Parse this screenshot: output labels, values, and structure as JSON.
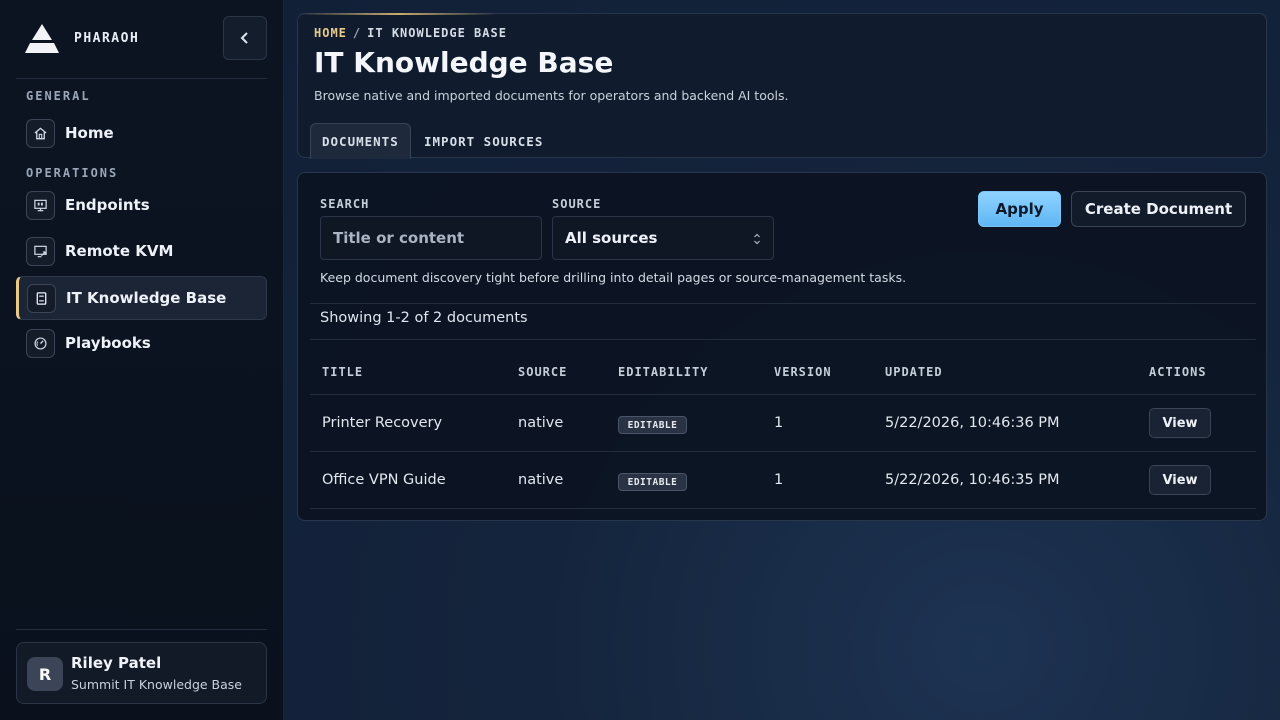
{
  "brand": {
    "name": "PHARAOH"
  },
  "sidebar": {
    "sections": [
      {
        "label": "GENERAL"
      },
      {
        "label": "OPERATIONS"
      }
    ],
    "items": [
      {
        "label": "Home",
        "icon": "home-icon"
      },
      {
        "label": "Endpoints",
        "icon": "monitor-icon"
      },
      {
        "label": "Remote KVM",
        "icon": "remote-screen-icon"
      },
      {
        "label": "IT Knowledge Base",
        "icon": "book-icon",
        "active": true
      },
      {
        "label": "Playbooks",
        "icon": "gauge-icon"
      }
    ],
    "user": {
      "initial": "R",
      "name": "Riley Patel",
      "org": "Summit IT Knowledge Base"
    }
  },
  "header": {
    "breadcrumb": {
      "home": "HOME",
      "sep": "/",
      "current": "IT KNOWLEDGE BASE"
    },
    "title": "IT Knowledge Base",
    "subtitle": "Browse native and imported documents for operators and backend AI tools.",
    "tabs": [
      {
        "label": "DOCUMENTS",
        "active": true
      },
      {
        "label": "IMPORT SOURCES"
      }
    ]
  },
  "filters": {
    "search": {
      "label": "SEARCH",
      "placeholder": "Title or content",
      "value": ""
    },
    "source": {
      "label": "SOURCE",
      "value": "All sources"
    },
    "apply_label": "Apply",
    "create_label": "Create Document",
    "hint": "Keep document discovery tight before drilling into detail pages or source-management tasks."
  },
  "results": {
    "count_text": "Showing 1-2 of 2 documents",
    "columns": [
      "TITLE",
      "SOURCE",
      "EDITABILITY",
      "VERSION",
      "UPDATED",
      "ACTIONS"
    ],
    "rows": [
      {
        "title": "Printer Recovery",
        "source": "native",
        "editability": "EDITABLE",
        "version": "1",
        "updated": "5/22/2026, 10:46:36 PM",
        "action": "View"
      },
      {
        "title": "Office VPN Guide",
        "source": "native",
        "editability": "EDITABLE",
        "version": "1",
        "updated": "5/22/2026, 10:46:35 PM",
        "action": "View"
      }
    ]
  },
  "colors": {
    "accent": "#e7c98a",
    "primary": "#6fbff7",
    "background": "#0e1a2c"
  }
}
